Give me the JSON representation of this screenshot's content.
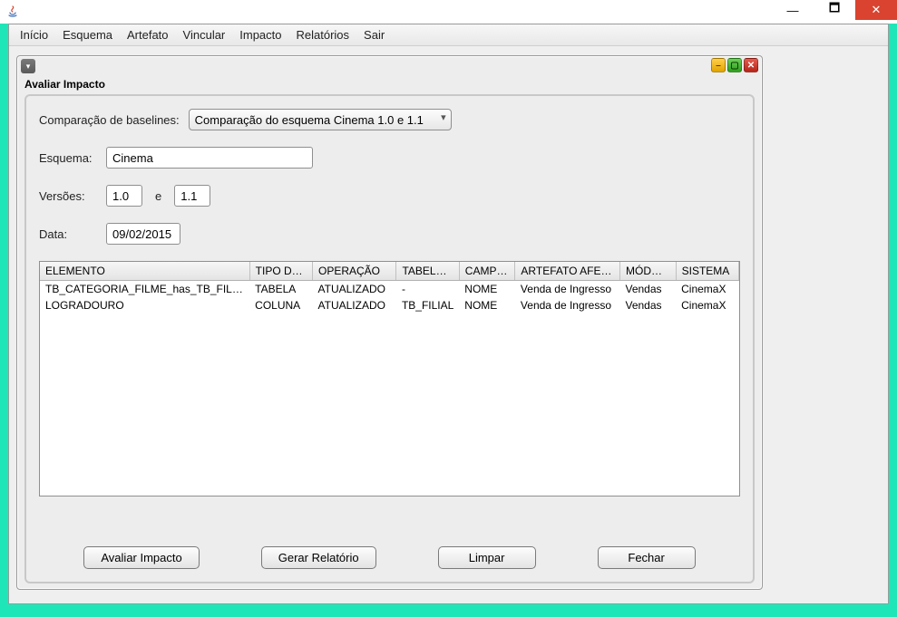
{
  "menubar": {
    "items": [
      "Início",
      "Esquema",
      "Artefato",
      "Vincular",
      "Impacto",
      "Relatórios",
      "Sair"
    ]
  },
  "panel": {
    "title": "Avaliar Impacto",
    "labels": {
      "comparison": "Comparação de baselines:",
      "schema": "Esquema:",
      "versions": "Versões:",
      "and": "e",
      "date": "Data:"
    },
    "values": {
      "comparison_selected": "Comparação do esquema Cinema 1.0 e 1.1",
      "schema": "Cinema",
      "version_a": "1.0",
      "version_b": "1.1",
      "date": "09/02/2015"
    },
    "table": {
      "headers": [
        "ELEMENTO",
        "TIPO DE ...",
        "OPERAÇÃO",
        "TABELA ...",
        "CAMPO...",
        "ARTEFATO AFET...",
        "MÓDULO",
        "SISTEMA"
      ],
      "rows": [
        [
          "TB_CATEGORIA_FILME_has_TB_FILME",
          "TABELA",
          "ATUALIZADO",
          "-",
          "NOME",
          "Venda de Ingresso",
          "Vendas",
          "CinemaX"
        ],
        [
          "LOGRADOURO",
          "COLUNA",
          "ATUALIZADO",
          "TB_FILIAL",
          "NOME",
          "Venda de Ingresso",
          "Vendas",
          "CinemaX"
        ]
      ]
    },
    "buttons": {
      "evaluate": "Avaliar Impacto",
      "report": "Gerar Relatório",
      "clear": "Limpar",
      "close": "Fechar"
    }
  }
}
